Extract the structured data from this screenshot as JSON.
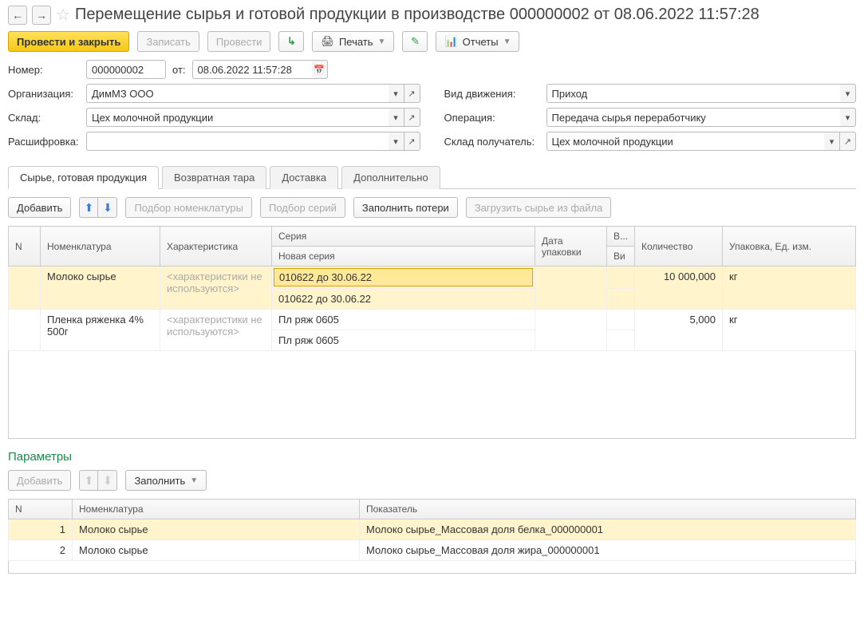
{
  "title": "Перемещение сырья и готовой продукции в производстве 000000002 от 08.06.2022 11:57:28",
  "toolbar": {
    "post_close": "Провести и закрыть",
    "save": "Записать",
    "post": "Провести",
    "print": "Печать",
    "reports": "Отчеты"
  },
  "form": {
    "number_label": "Номер:",
    "number": "000000002",
    "from_label": "от:",
    "date": "08.06.2022 11:57:28",
    "org_label": "Организация:",
    "org": "ДимМЗ ООО",
    "warehouse_label": "Склад:",
    "warehouse": "Цех молочной продукции",
    "decode_label": "Расшифровка:",
    "decode": "",
    "movement_label": "Вид движения:",
    "movement": "Приход",
    "operation_label": "Операция:",
    "operation": "Передача сырья переработчику",
    "dest_wh_label": "Склад получатель:",
    "dest_wh": "Цех молочной продукции"
  },
  "tabs": [
    "Сырье, готовая продукция",
    "Возвратная тара",
    "Доставка",
    "Дополнительно"
  ],
  "table_toolbar": {
    "add": "Добавить",
    "pick_nom": "Подбор номенклатуры",
    "pick_series": "Подбор серий",
    "fill_losses": "Заполнить потери",
    "load_file": "Загрузить сырье из файла"
  },
  "columns": {
    "n": "N",
    "nom": "Номенклатура",
    "char": "Характеристика",
    "series": "Серия",
    "new_series": "Новая серия",
    "pack_date": "Дата упаковки",
    "b": "В...",
    "vi": "Ви",
    "qty": "Количество",
    "unit": "Упаковка, Ед. изм."
  },
  "rows": [
    {
      "nom": "Молоко сырье",
      "char": "<характеристики не используются>",
      "series": "010622 до 30.06.22",
      "new_series": "010622 до 30.06.22",
      "qty": "10 000,000",
      "unit": "кг",
      "highlight": true
    },
    {
      "nom": "Пленка ряженка 4% 500г",
      "char": "<характеристики не используются>",
      "series": "Пл ряж 0605",
      "new_series": "Пл ряж 0605",
      "qty": "5,000",
      "unit": "кг"
    }
  ],
  "params": {
    "title": "Параметры",
    "add": "Добавить",
    "fill": "Заполнить",
    "columns": {
      "n": "N",
      "nom": "Номенклатура",
      "indicator": "Показатель"
    },
    "rows": [
      {
        "n": "1",
        "nom": "Молоко сырье",
        "indicator": "Молоко сырье_Массовая доля белка_000000001",
        "highlight": true
      },
      {
        "n": "2",
        "nom": "Молоко сырье",
        "indicator": "Молоко сырье_Массовая доля жира_000000001"
      }
    ]
  }
}
